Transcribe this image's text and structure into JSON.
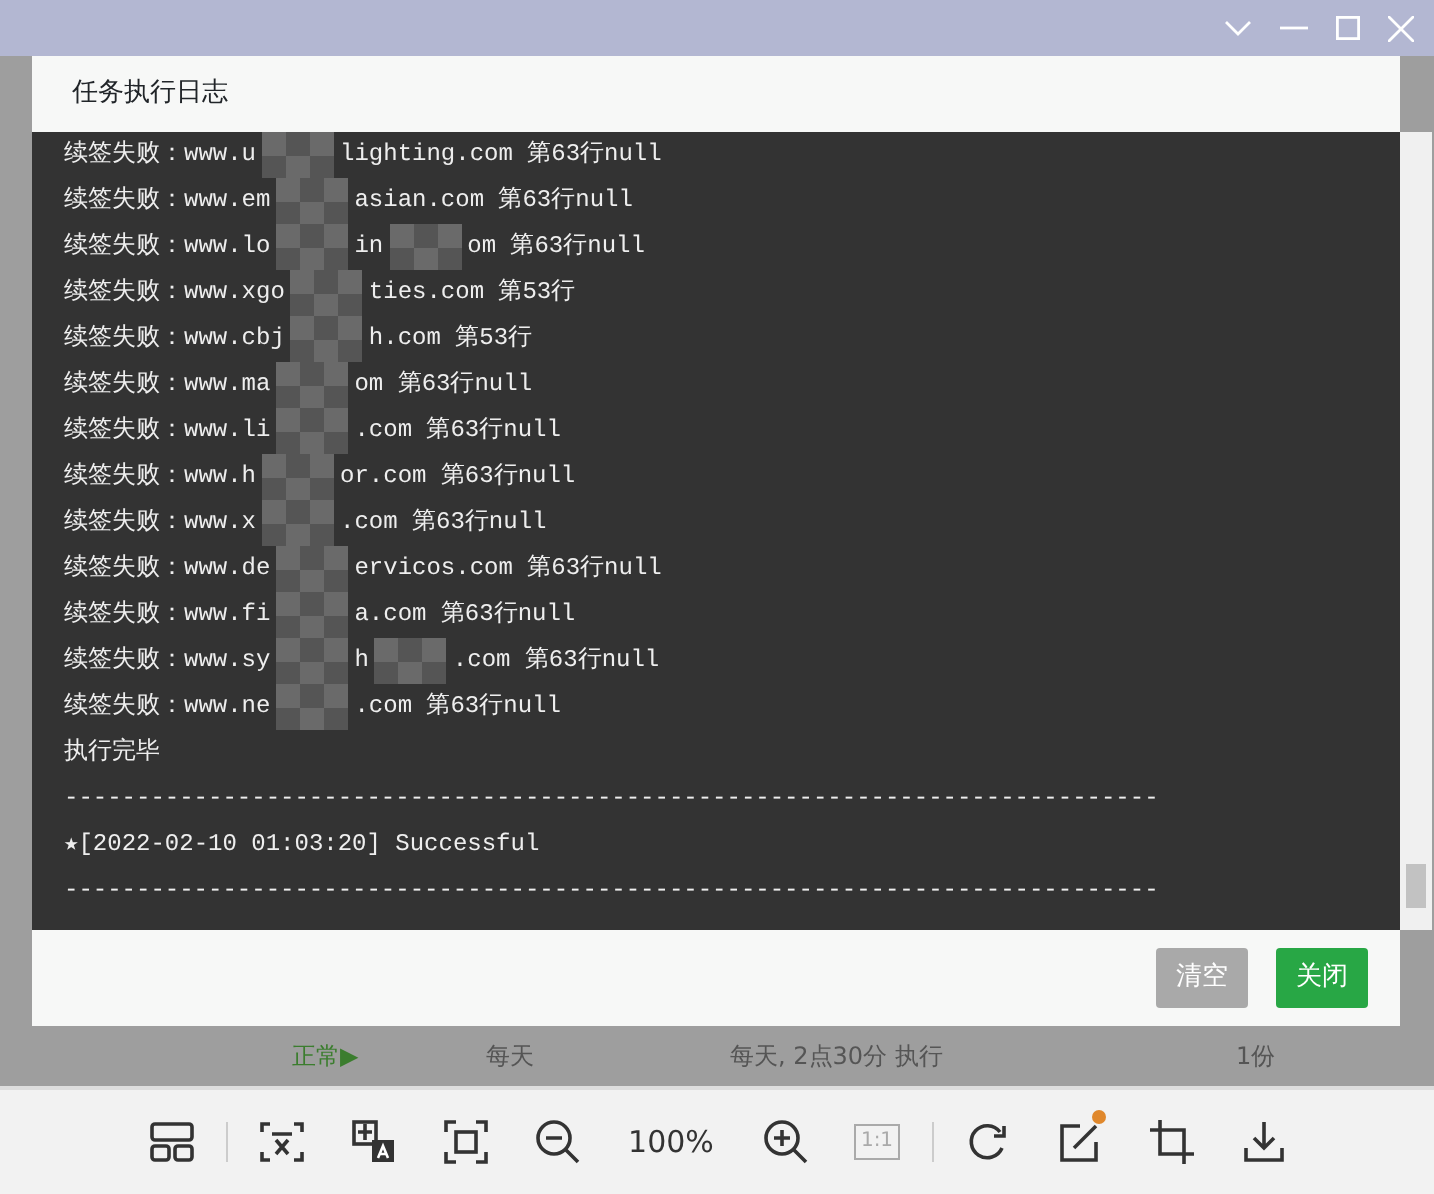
{
  "dialog": {
    "title": "任务执行日志",
    "log_lines": [
      {
        "segments": [
          "续签失败：www.u",
          "lighting.com 第63行null"
        ]
      },
      {
        "segments": [
          "续签失败：www.em",
          "asian.com 第63行null"
        ]
      },
      {
        "segments": [
          "续签失败：www.lo",
          "in",
          "om 第63行null"
        ]
      },
      {
        "segments": [
          "续签失败：www.xgo",
          "ties.com 第53行"
        ]
      },
      {
        "segments": [
          "续签失败：www.cbj",
          "h.com 第53行"
        ]
      },
      {
        "segments": [
          "续签失败：www.ma",
          "om 第63行null"
        ]
      },
      {
        "segments": [
          "续签失败：www.li",
          ".com 第63行null"
        ]
      },
      {
        "segments": [
          "续签失败：www.h",
          "or.com 第63行null"
        ]
      },
      {
        "segments": [
          "续签失败：www.x",
          ".com 第63行null"
        ]
      },
      {
        "segments": [
          "续签失败：www.de",
          "ervicos.com 第63行null"
        ]
      },
      {
        "segments": [
          "续签失败：www.fi",
          "a.com 第63行null"
        ]
      },
      {
        "segments": [
          "续签失败：www.sy",
          "h",
          ".com 第63行null"
        ]
      },
      {
        "segments": [
          "续签失败：www.ne",
          ".com 第63行null"
        ]
      },
      {
        "segments": [
          "执行完毕"
        ]
      },
      {
        "segments": [
          "----------------------------------------------------------------------------"
        ]
      },
      {
        "segments": [
          "★[2022-02-10 01:03:20] Successful"
        ]
      },
      {
        "segments": [
          "----------------------------------------------------------------------------"
        ]
      }
    ],
    "buttons": [
      {
        "label": "清空",
        "disabled": true
      },
      {
        "label": "关闭",
        "disabled": false
      }
    ]
  },
  "background_row": {
    "status": "正常▶",
    "cells": [
      "每天",
      "每天, 2点30分 执行",
      "1份"
    ]
  },
  "toolbar": {
    "zoom": "100%",
    "actual_size": {
      "label": "1:1",
      "disabled": true
    },
    "edit_has_dot": true
  }
}
